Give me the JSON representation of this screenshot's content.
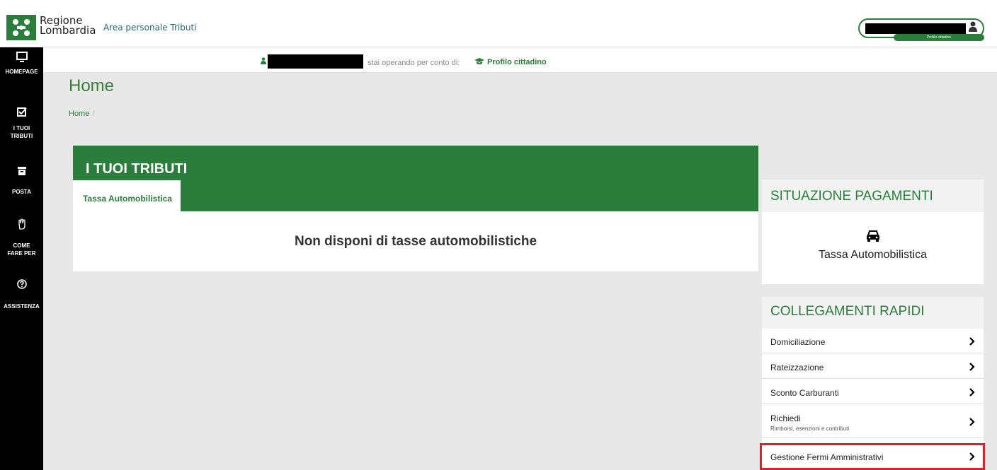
{
  "header": {
    "logo_line1": "Regione",
    "logo_line2": "Lombardia",
    "area_title": "Area personale Tributi",
    "profile_badge": "Profilo cittadino"
  },
  "sidebar": {
    "items": [
      {
        "label": "HOMEPAGE",
        "icon": "monitor-icon"
      },
      {
        "label_line1": "I TUOI",
        "label_line2": "TRIBUTI",
        "icon": "checkbox-icon"
      },
      {
        "label": "POSTA",
        "icon": "archive-icon"
      },
      {
        "label_line1": "COME",
        "label_line2": "FARE PER",
        "icon": "hand-icon"
      },
      {
        "label": "ASSISTENZA",
        "icon": "question-circle-icon"
      }
    ]
  },
  "subbar": {
    "operating_text": "stai operando per conto di:",
    "profile_text": "Profilo cittadino"
  },
  "main": {
    "title": "Home",
    "breadcrumb": "Home",
    "breadcrumb_sep": "/"
  },
  "tributi": {
    "title": "I TUOI TRIBUTI",
    "tab": "Tassa Automobilistica",
    "empty_message": "Non disponi di tasse automobilistiche"
  },
  "situazione": {
    "title": "SITUAZIONE PAGAMENTI",
    "item": "Tassa Automobilistica"
  },
  "collegamenti": {
    "title": "COLLEGAMENTI RAPIDI",
    "links": [
      {
        "label": "Domiciliazione",
        "sub": ""
      },
      {
        "label": "Rateizzazione",
        "sub": ""
      },
      {
        "label": "Sconto Carburanti",
        "sub": ""
      },
      {
        "label": "Richiedi",
        "sub": "Rimborsi, esenzioni e contributi"
      },
      {
        "label": "Gestione Fermi Amministrativi",
        "sub": ""
      }
    ]
  },
  "colors": {
    "brand_green": "#2a7d3b",
    "highlight_red": "#e01e2b"
  }
}
